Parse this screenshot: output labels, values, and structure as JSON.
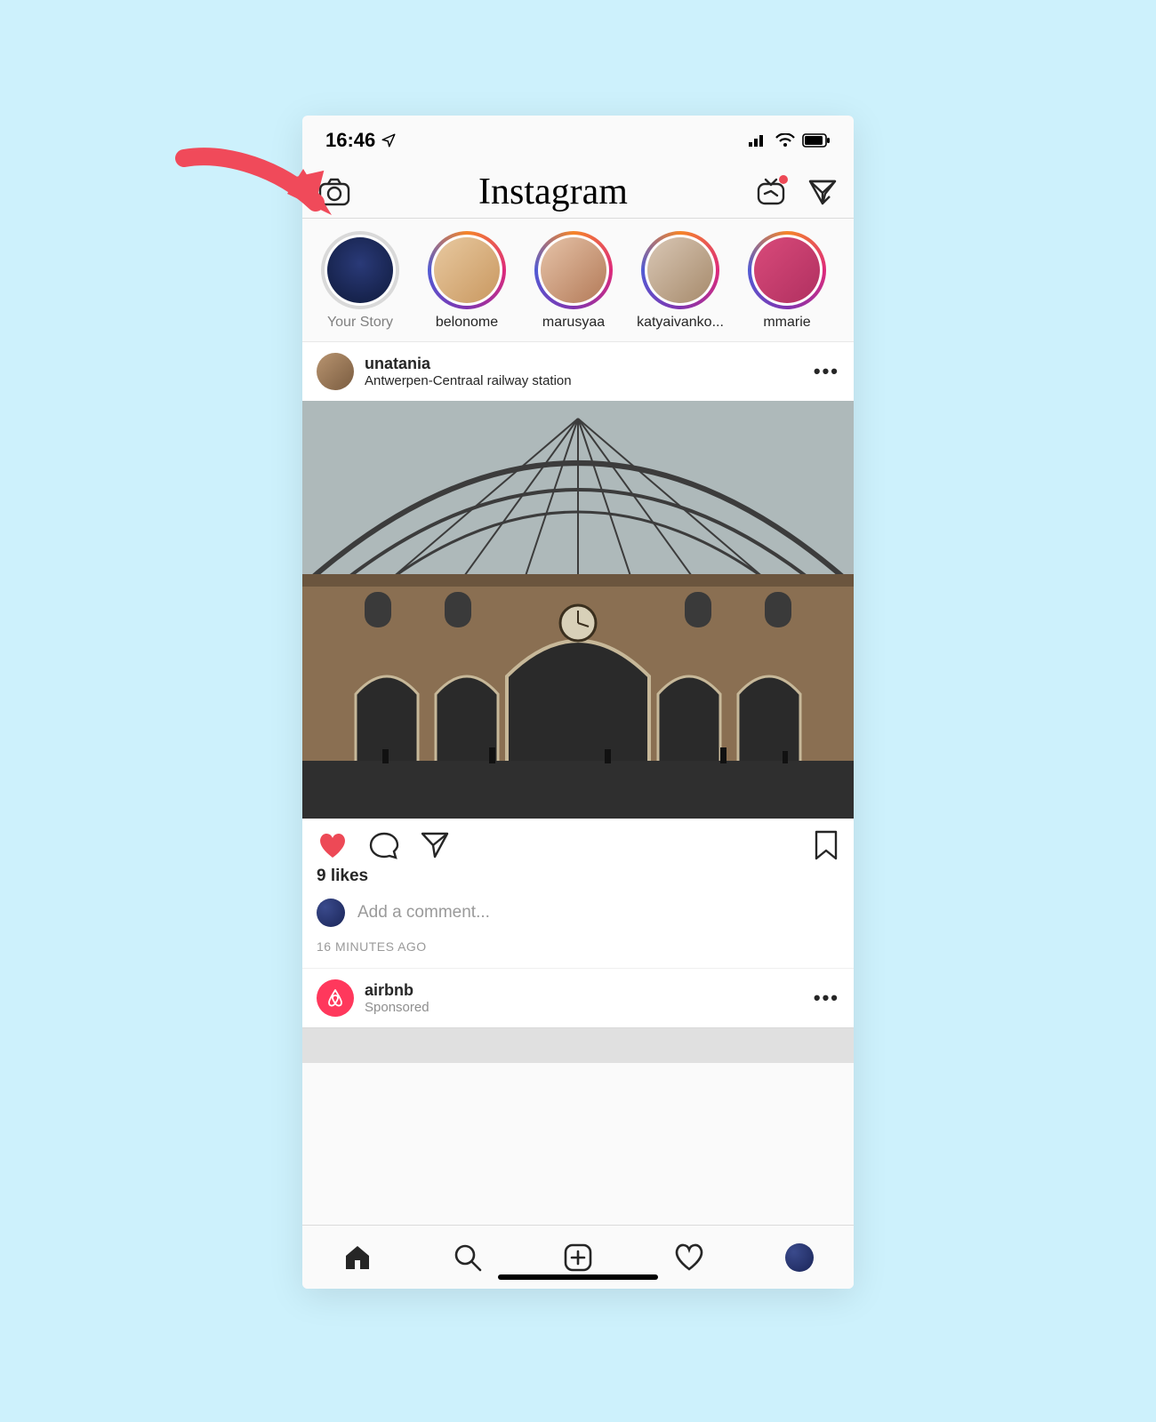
{
  "annotation": {
    "arrow_color": "#f04a5a"
  },
  "status": {
    "time": "16:46"
  },
  "topnav": {
    "brand": "Instagram"
  },
  "stories": [
    {
      "label": "Your Story",
      "seen": true,
      "avatar_bg": "radial-gradient(circle at 50% 40%, #2a3a78, #0f1a3c)",
      "label_dark": false
    },
    {
      "label": "belonome",
      "seen": false,
      "avatar_bg": "linear-gradient(135deg,#e8c9a0,#c99860)",
      "label_dark": true
    },
    {
      "label": "marusyaa",
      "seen": false,
      "avatar_bg": "linear-gradient(135deg,#e6c3a8,#b37a58)",
      "label_dark": true
    },
    {
      "label": "katyaivanko...",
      "seen": false,
      "avatar_bg": "linear-gradient(135deg,#d9c7b5,#a68a6b)",
      "label_dark": true
    },
    {
      "label": "mmarie",
      "seen": false,
      "avatar_bg": "linear-gradient(135deg,#d94a7a,#b03060)",
      "label_dark": true
    }
  ],
  "post": {
    "username": "unatania",
    "location": "Antwerpen-Centraal railway station",
    "liked": true,
    "likes_text": "9 likes",
    "comment_placeholder": "Add a comment...",
    "timestamp": "16 MINUTES AGO"
  },
  "sponsored": {
    "username": "airbnb",
    "label": "Sponsored"
  },
  "colors": {
    "like_red": "#ed4956",
    "airbnb": "#ff385c"
  }
}
